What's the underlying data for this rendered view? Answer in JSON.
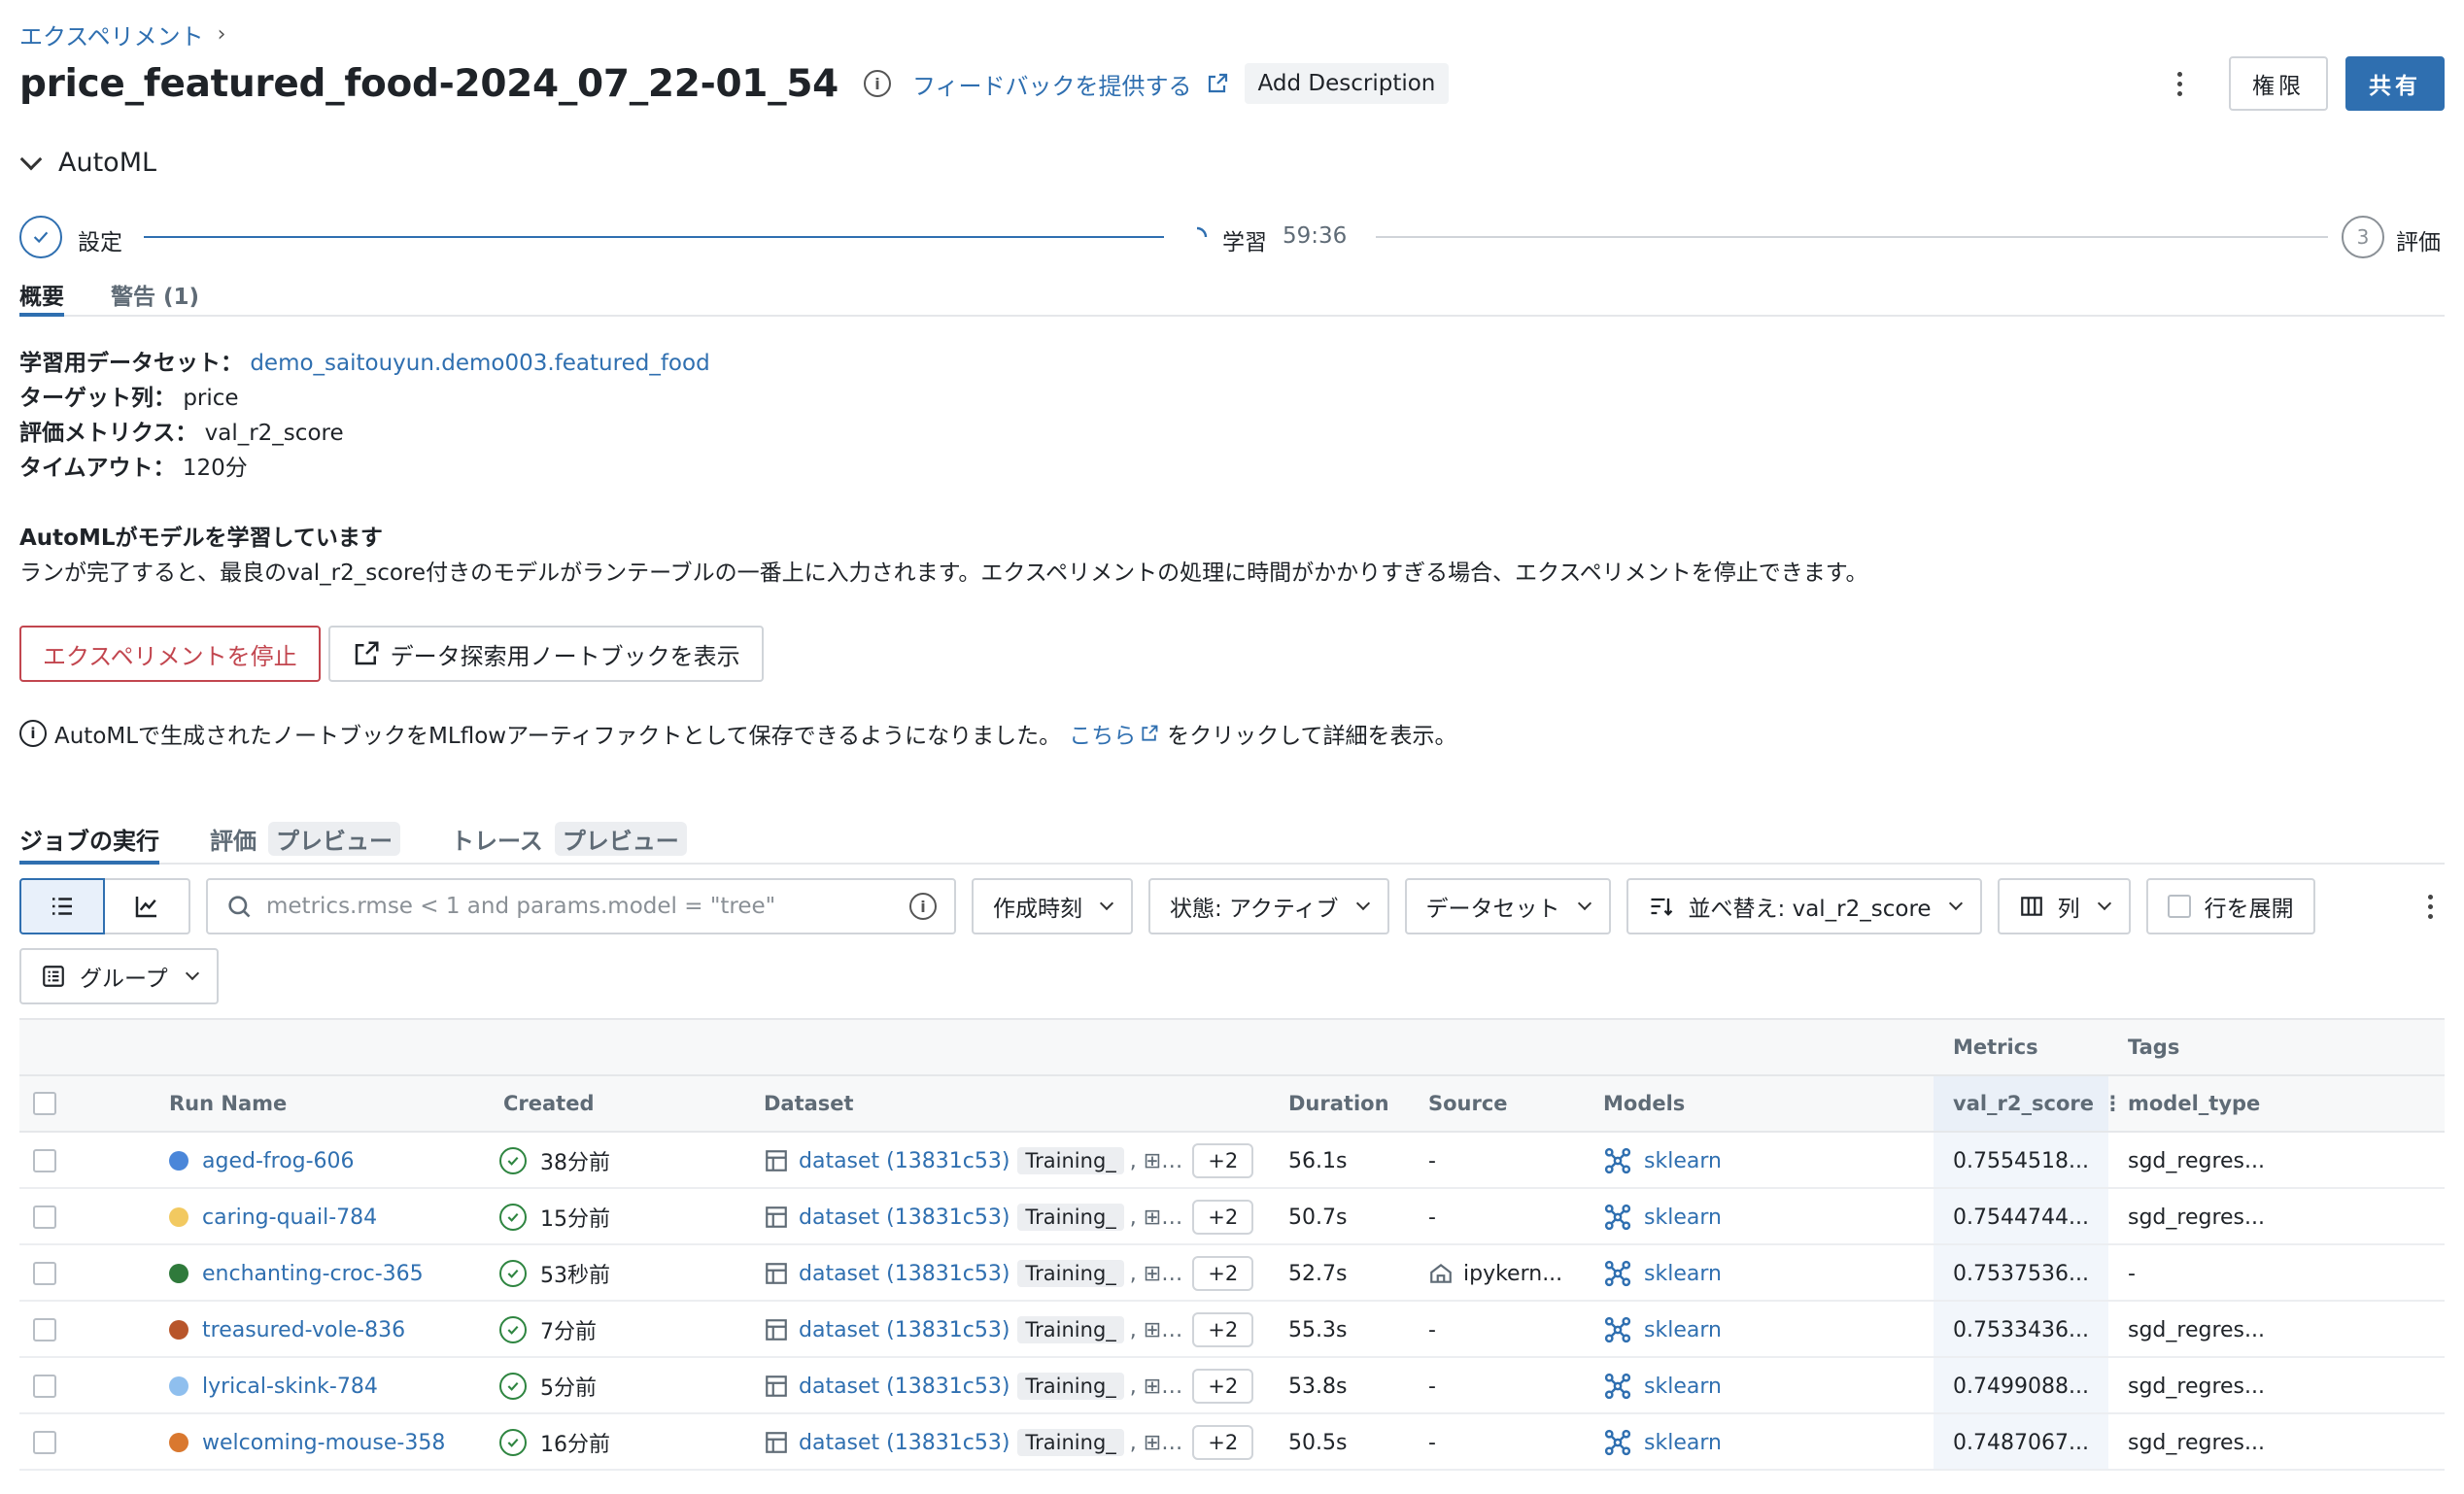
{
  "breadcrumb": {
    "label": "エクスペリメント"
  },
  "header": {
    "title": "price_featured_food-2024_07_22-01_54",
    "feedback_label": "フィードバックを提供する",
    "add_description_label": "Add Description",
    "permissions_label": "権限",
    "share_label": "共有"
  },
  "automl": {
    "section_label": "AutoML",
    "steps": [
      {
        "label": "設定",
        "state": "done"
      },
      {
        "label": "学習",
        "state": "in-progress",
        "elapsed": "59:36"
      },
      {
        "label": "評価",
        "number": "3",
        "state": "pending"
      }
    ]
  },
  "tabs": [
    {
      "label": "概要",
      "active": true
    },
    {
      "label": "警告 (1)",
      "active": false
    }
  ],
  "overview": {
    "dataset_key": "学習用データセット：",
    "dataset_value": "demo_saitouyun.demo003.featured_food",
    "target_key": "ターゲット列：",
    "target_value": "price",
    "metric_key": "評価メトリクス：",
    "metric_value": "val_r2_score",
    "timeout_key": "タイムアウト：",
    "timeout_value": "120分"
  },
  "status": {
    "title": "AutoMLがモデルを学習しています",
    "description": "ランが完了すると、最良のval_r2_score付きのモデルがランテーブルの一番上に入力されます。エクスペリメントの処理に時間がかかりすぎる場合、エクスペリメントを停止できます。"
  },
  "actions": {
    "stop_label": "エクスペリメントを停止",
    "notebook_label": "データ探索用ノートブックを表示"
  },
  "notice": {
    "text_before": "AutoMLで生成されたノートブックをMLflowアーティファクトとして保存できるようになりました。",
    "link_label": "こちら",
    "text_after": "をクリックして詳細を表示。"
  },
  "run_tabs": [
    {
      "label": "ジョブの実行",
      "active": true
    },
    {
      "label": "評価",
      "badge": "プレビュー"
    },
    {
      "label": "トレース",
      "badge": "プレビュー"
    }
  ],
  "toolbar": {
    "search_placeholder": "metrics.rmse < 1 and params.model = \"tree\"",
    "created_label": "作成時刻",
    "state_label": "状態: アクティブ",
    "dataset_label": "データセット",
    "sort_label": "並べ替え: val_r2_score",
    "columns_label": "列",
    "expand_rows_label": "行を展開",
    "group_label": "グループ"
  },
  "table": {
    "group_headers": {
      "metrics": "Metrics",
      "tags": "Tags"
    },
    "columns": {
      "run_name": "Run Name",
      "created": "Created",
      "dataset": "Dataset",
      "duration": "Duration",
      "source": "Source",
      "models": "Models",
      "metric": "val_r2_score",
      "tag": "model_type"
    },
    "rows": [
      {
        "name": "aged-frog-606",
        "color": "#4a86d9",
        "created": "38分前",
        "dataset": "dataset (13831c53)",
        "tag": "Training_",
        "more": "+2",
        "duration": "56.1s",
        "source": "-",
        "model": "sklearn",
        "metric": "0.7554518...",
        "model_type": "sgd_regres..."
      },
      {
        "name": "caring-quail-784",
        "color": "#f2c960",
        "created": "15分前",
        "dataset": "dataset (13831c53)",
        "tag": "Training_",
        "more": "+2",
        "duration": "50.7s",
        "source": "-",
        "model": "sklearn",
        "metric": "0.7544744...",
        "model_type": "sgd_regres..."
      },
      {
        "name": "enchanting-croc-365",
        "color": "#2f7a3b",
        "created": "53秒前",
        "dataset": "dataset (13831c53)",
        "tag": "Training_",
        "more": "+2",
        "duration": "52.7s",
        "source": "ipykern...",
        "model": "sklearn",
        "metric": "0.7537536...",
        "model_type": "-"
      },
      {
        "name": "treasured-vole-836",
        "color": "#b8552a",
        "created": "7分前",
        "dataset": "dataset (13831c53)",
        "tag": "Training_",
        "more": "+2",
        "duration": "55.3s",
        "source": "-",
        "model": "sklearn",
        "metric": "0.7533436...",
        "model_type": "sgd_regres..."
      },
      {
        "name": "lyrical-skink-784",
        "color": "#8fbfee",
        "created": "5分前",
        "dataset": "dataset (13831c53)",
        "tag": "Training_",
        "more": "+2",
        "duration": "53.8s",
        "source": "-",
        "model": "sklearn",
        "metric": "0.7499088...",
        "model_type": "sgd_regres..."
      },
      {
        "name": "welcoming-mouse-358",
        "color": "#d9782f",
        "created": "16分前",
        "dataset": "dataset (13831c53)",
        "tag": "Training_",
        "more": "+2",
        "duration": "50.5s",
        "source": "-",
        "model": "sklearn",
        "metric": "0.7487067...",
        "model_type": "sgd_regres..."
      }
    ]
  },
  "colors": {
    "accent": "#2f6fb0",
    "danger": "#c2464f",
    "success": "#2e8540"
  }
}
